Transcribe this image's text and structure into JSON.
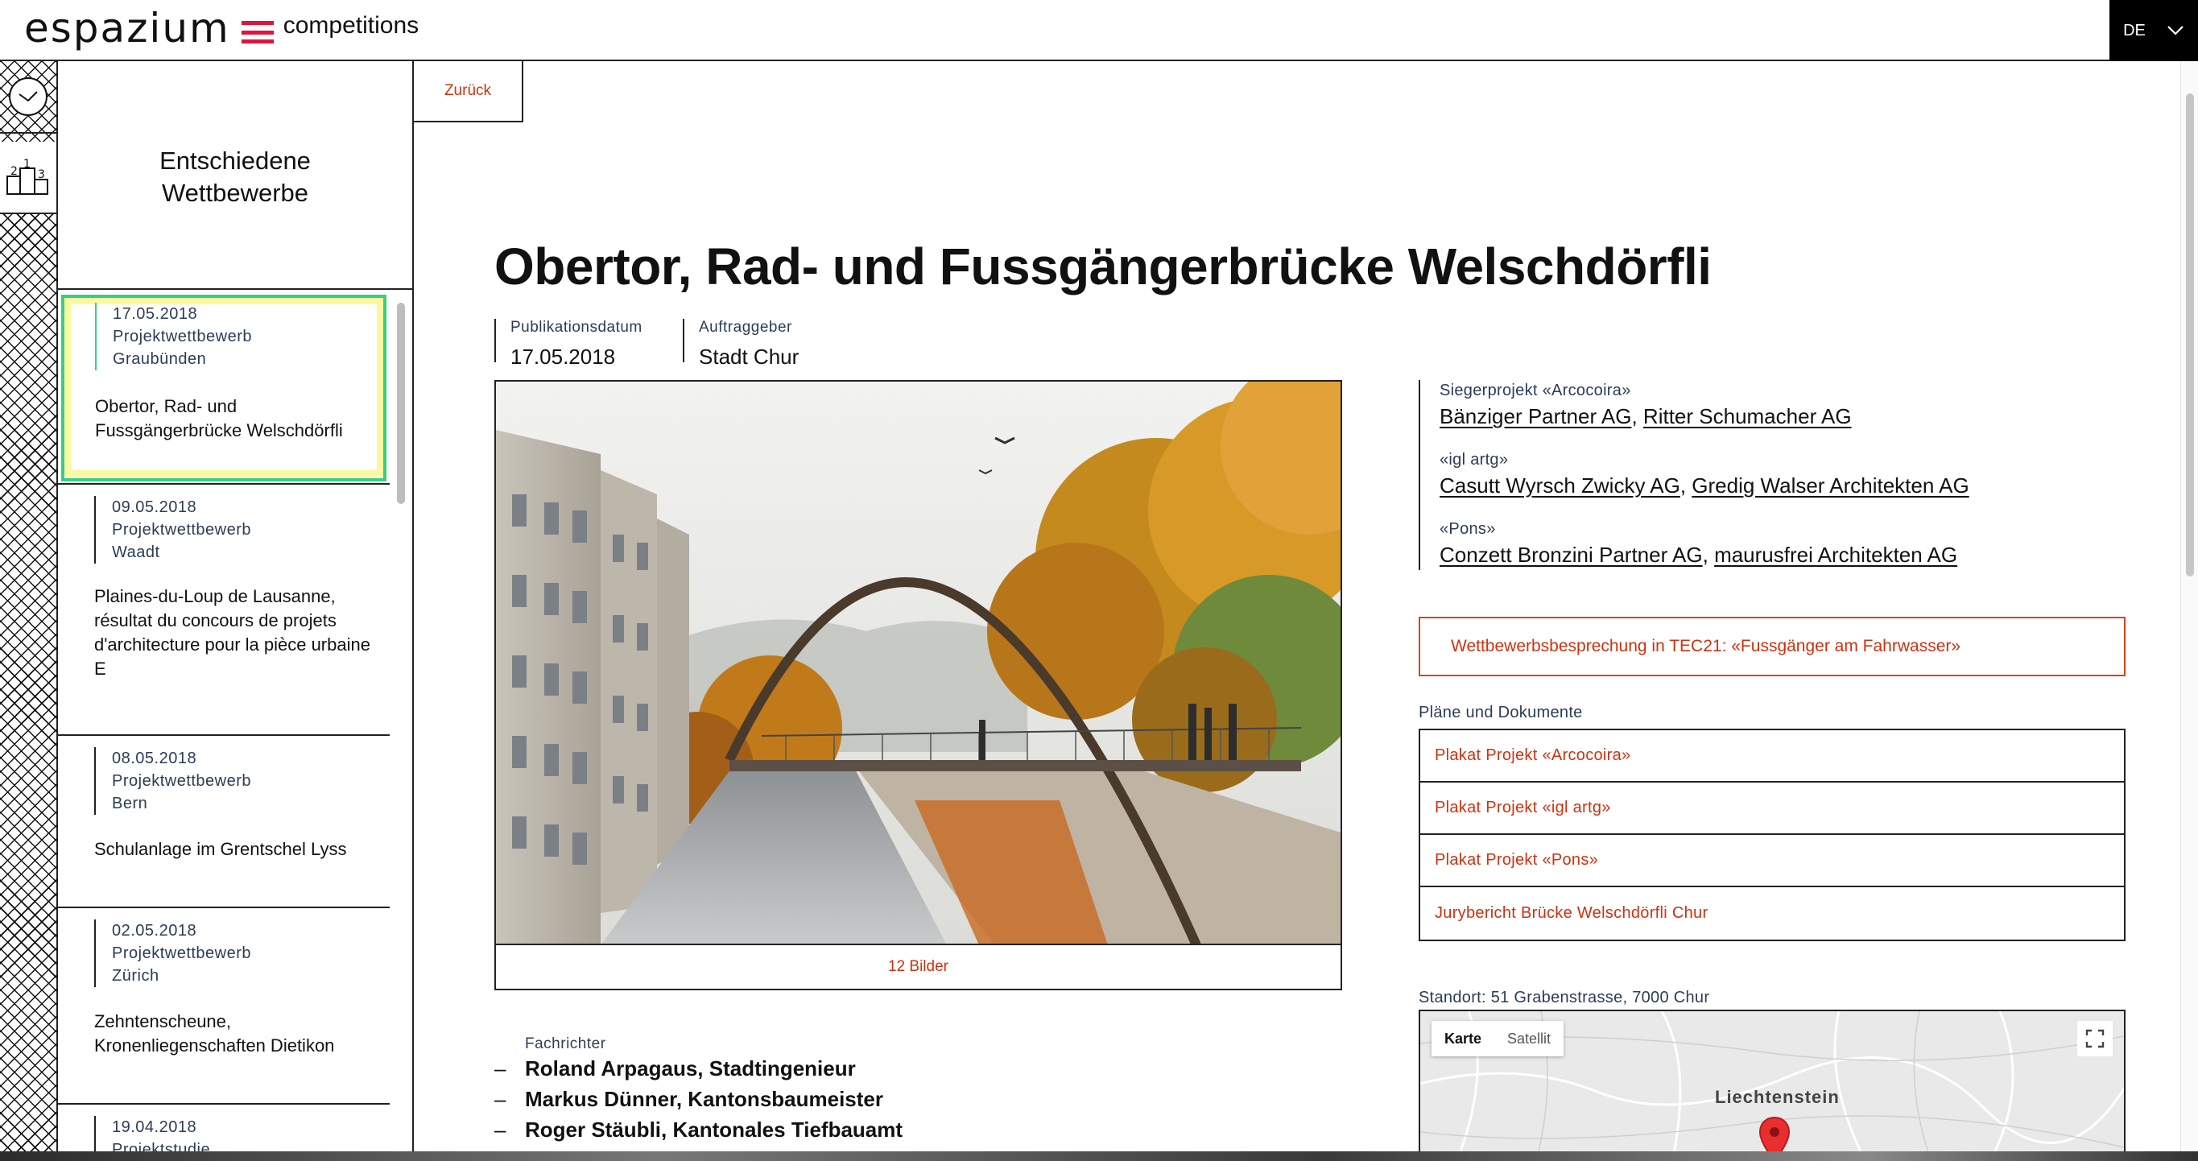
{
  "header": {
    "logo_word": "espazium",
    "logo_sub": "competitions",
    "language": "DE"
  },
  "sidebar": {
    "title_line1": "Entschiedene",
    "title_line2": "Wettbewerbe",
    "items": [
      {
        "date": "17.05.2018",
        "type": "Projektwettbewerb",
        "region": "Graubünden",
        "title": "Obertor, Rad- und Fussgängerbrücke Welschdörfli"
      },
      {
        "date": "09.05.2018",
        "type": "Projektwettbewerb",
        "region": "Waadt",
        "title": "Plaines-du-Loup de Lausanne, résultat du concours de projets d'architecture pour la pièce urbaine E"
      },
      {
        "date": "08.05.2018",
        "type": "Projektwettbewerb",
        "region": "Bern",
        "title": "Schulanlage im Grentschel Lyss"
      },
      {
        "date": "02.05.2018",
        "type": "Projektwettbewerb",
        "region": "Zürich",
        "title": "Zehntenscheune, Kronenliegenschaften Dietikon"
      },
      {
        "date": "19.04.2018",
        "type": "Projektstudie",
        "region": "",
        "title": ""
      }
    ]
  },
  "main": {
    "back_label": "Zurück",
    "title": "Obertor, Rad- und Fussgängerbrücke Welschdörfli",
    "pub_label": "Publikationsdatum",
    "pub_value": "17.05.2018",
    "client_label": "Auftraggeber",
    "client_value": "Stadt Chur",
    "gallery_caption": "12 Bilder",
    "jury_label": "Fachrichter",
    "jury": [
      "Roland Arpagaus, Stadtingenieur",
      "Markus Dünner, Kantonsbaumeister",
      "Roger Stäubli, Kantonales Tiefbauamt"
    ],
    "winners": [
      {
        "label": "Siegerprojekt «Arcocoira»",
        "firm1": "Bänziger Partner AG",
        "firm2": "Ritter Schumacher AG"
      },
      {
        "label": "«igl artg»",
        "firm1": "Casutt Wyrsch Zwicky AG",
        "firm2": "Gredig Walser Architekten AG"
      },
      {
        "label": "«Pons»",
        "firm1": "Conzett Bronzini Partner AG",
        "firm2": "maurusfrei Architekten AG"
      }
    ],
    "article_link": "Wettbewerbsbesprechung in TEC21: «Fussgänger am Fahrwasser»",
    "docs_label": "Pläne und Dokumente",
    "docs": [
      "Plakat Projekt «Arcocoira»",
      "Plakat Projekt «igl artg»",
      "Plakat Projekt «Pons»",
      "Jurybericht Brücke Welschdörfli Chur"
    ],
    "location_label": "Standort: 51 Grabenstrasse, 7000 Chur",
    "map": {
      "tab_map": "Karte",
      "tab_satellite": "Satellit",
      "place_label": "Liechtenstein"
    }
  },
  "colors": {
    "accent_red": "#d2300e",
    "logo_red": "#e0143c",
    "meta_blue": "#2a3d56",
    "active_green": "#35d07f",
    "active_yellow": "#fbf8a2"
  },
  "icons": [
    "check-icon",
    "podium-icon",
    "chevron-down-icon",
    "fullscreen-icon",
    "map-pin-icon"
  ]
}
